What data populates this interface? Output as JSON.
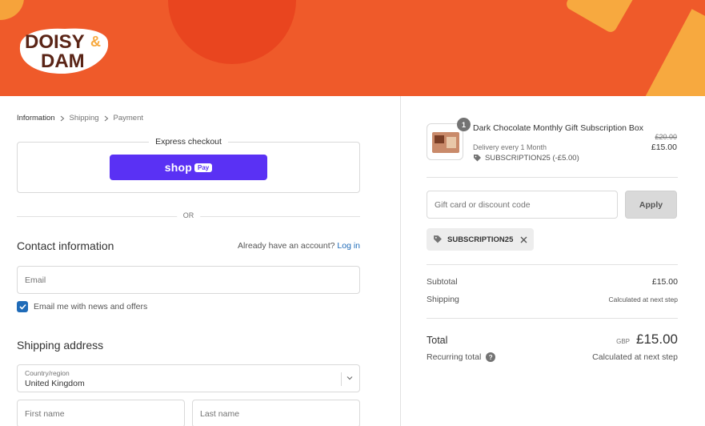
{
  "brand": {
    "logo_text_top": "DOISY",
    "logo_text_bottom": "DAM",
    "logo_amp": "&",
    "colors": {
      "banner": "#ef5a2a",
      "accent_orange": "#f7a93f",
      "logo_brown": "#5a2416",
      "link": "#1f6bb8",
      "shop_pay": "#5a31f4"
    }
  },
  "breadcrumb": {
    "items": [
      {
        "label": "Information",
        "current": true
      },
      {
        "label": "Shipping",
        "current": false
      },
      {
        "label": "Payment",
        "current": false
      }
    ],
    "separator_icon": "chevron-right-icon"
  },
  "express": {
    "title": "Express checkout",
    "shop_word": "shop",
    "pay_word": "Pay"
  },
  "or_text": "OR",
  "contact": {
    "title": "Contact information",
    "have_account": "Already have an account?",
    "login_link": "Log in",
    "email_placeholder": "Email",
    "newsletter_label": "Email me with news and offers",
    "newsletter_checked": true
  },
  "shipping": {
    "title": "Shipping address",
    "country_label": "Country/region",
    "country_value": "United Kingdom",
    "first_name_placeholder": "First name",
    "last_name_placeholder": "Last name"
  },
  "cart": {
    "item": {
      "quantity": "1",
      "name": "Dark Chocolate Monthly Gift Subscription Box",
      "delivery": "Delivery every 1 Month",
      "discount": "SUBSCRIPTION25 (-£5.00)",
      "original_price": "£20.00",
      "price": "£15.00"
    },
    "discount_placeholder": "Gift card or discount code",
    "apply_label": "Apply",
    "applied_code": "SUBSCRIPTION25",
    "subtotal_label": "Subtotal",
    "subtotal_value": "£15.00",
    "shipping_label": "Shipping",
    "shipping_value": "Calculated at next step",
    "total_label": "Total",
    "total_currency": "GBP",
    "total_value": "£15.00",
    "recurring_label": "Recurring total",
    "recurring_value": "Calculated at next step"
  }
}
